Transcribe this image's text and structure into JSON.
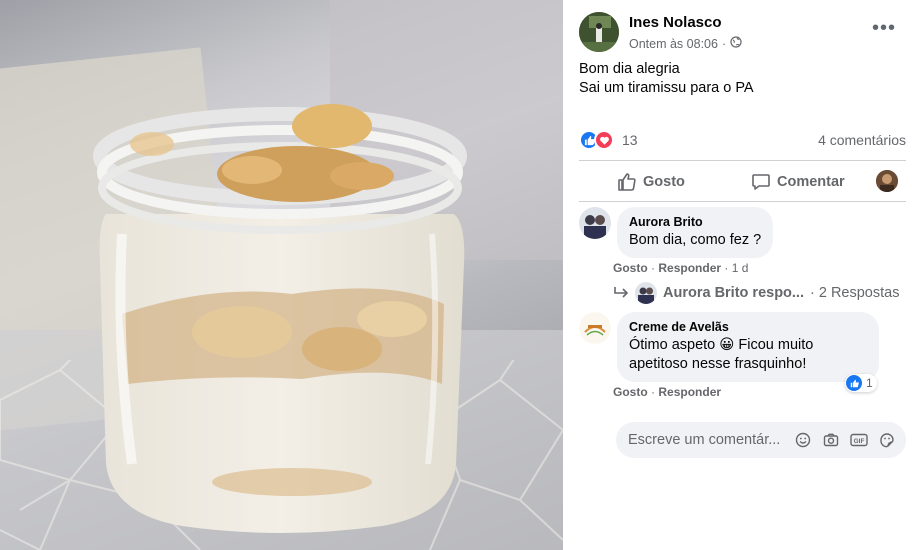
{
  "post": {
    "author": "Ines Nolasco",
    "timestamp": "Ontem às 08:06",
    "privacy_icon": "globe-icon",
    "text_line1": "Bom dia alegria",
    "text_line2": "Sai um tiramissu para o PA",
    "reaction_count": "13",
    "comments_count": "4 comentários"
  },
  "actions": {
    "like_label": "Gosto",
    "comment_label": "Comentar"
  },
  "comments": [
    {
      "author": "Aurora Brito",
      "text": "Bom dia, como fez ?",
      "like_link": "Gosto",
      "reply_link": "Responder",
      "time": "1 d",
      "replies_preview": "Aurora Brito respo...",
      "replies_count": "· 2 Respostas"
    },
    {
      "author": "Creme de Avelãs",
      "text_line1": "Ótimo aspeto 😀 Ficou muito",
      "text_line2": "apetitoso nesse frasquinho!",
      "like_link": "Gosto",
      "reply_link": "Responder",
      "like_count": "1"
    }
  ],
  "composer": {
    "placeholder": "Escreve um comentár..."
  },
  "colors": {
    "like_blue": "#1877f2",
    "love_red": "#f33e58",
    "secondary_text": "#65676b",
    "bubble_bg": "#f0f2f5"
  }
}
